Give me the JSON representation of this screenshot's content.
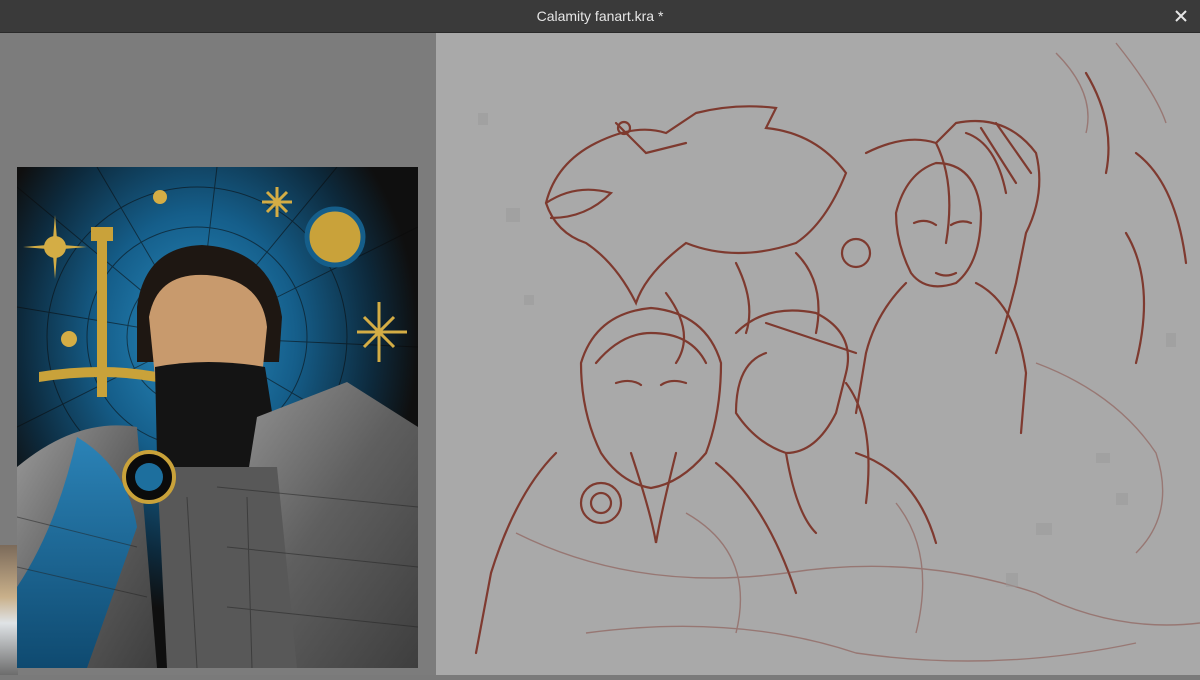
{
  "window": {
    "title": "Calamity fanart.kra *",
    "close_icon": "close-icon"
  },
  "reference_panel": {
    "image_name": "stained-glass-warrior-reference",
    "colors": {
      "blue": "#1d6f9e",
      "gold": "#c9a23a",
      "armor": "#7a7a7a",
      "background": "#111111"
    }
  },
  "canvas": {
    "image_name": "sketch-canvas",
    "stroke_color": "#7a2e22",
    "background": "#a9a9a9"
  }
}
